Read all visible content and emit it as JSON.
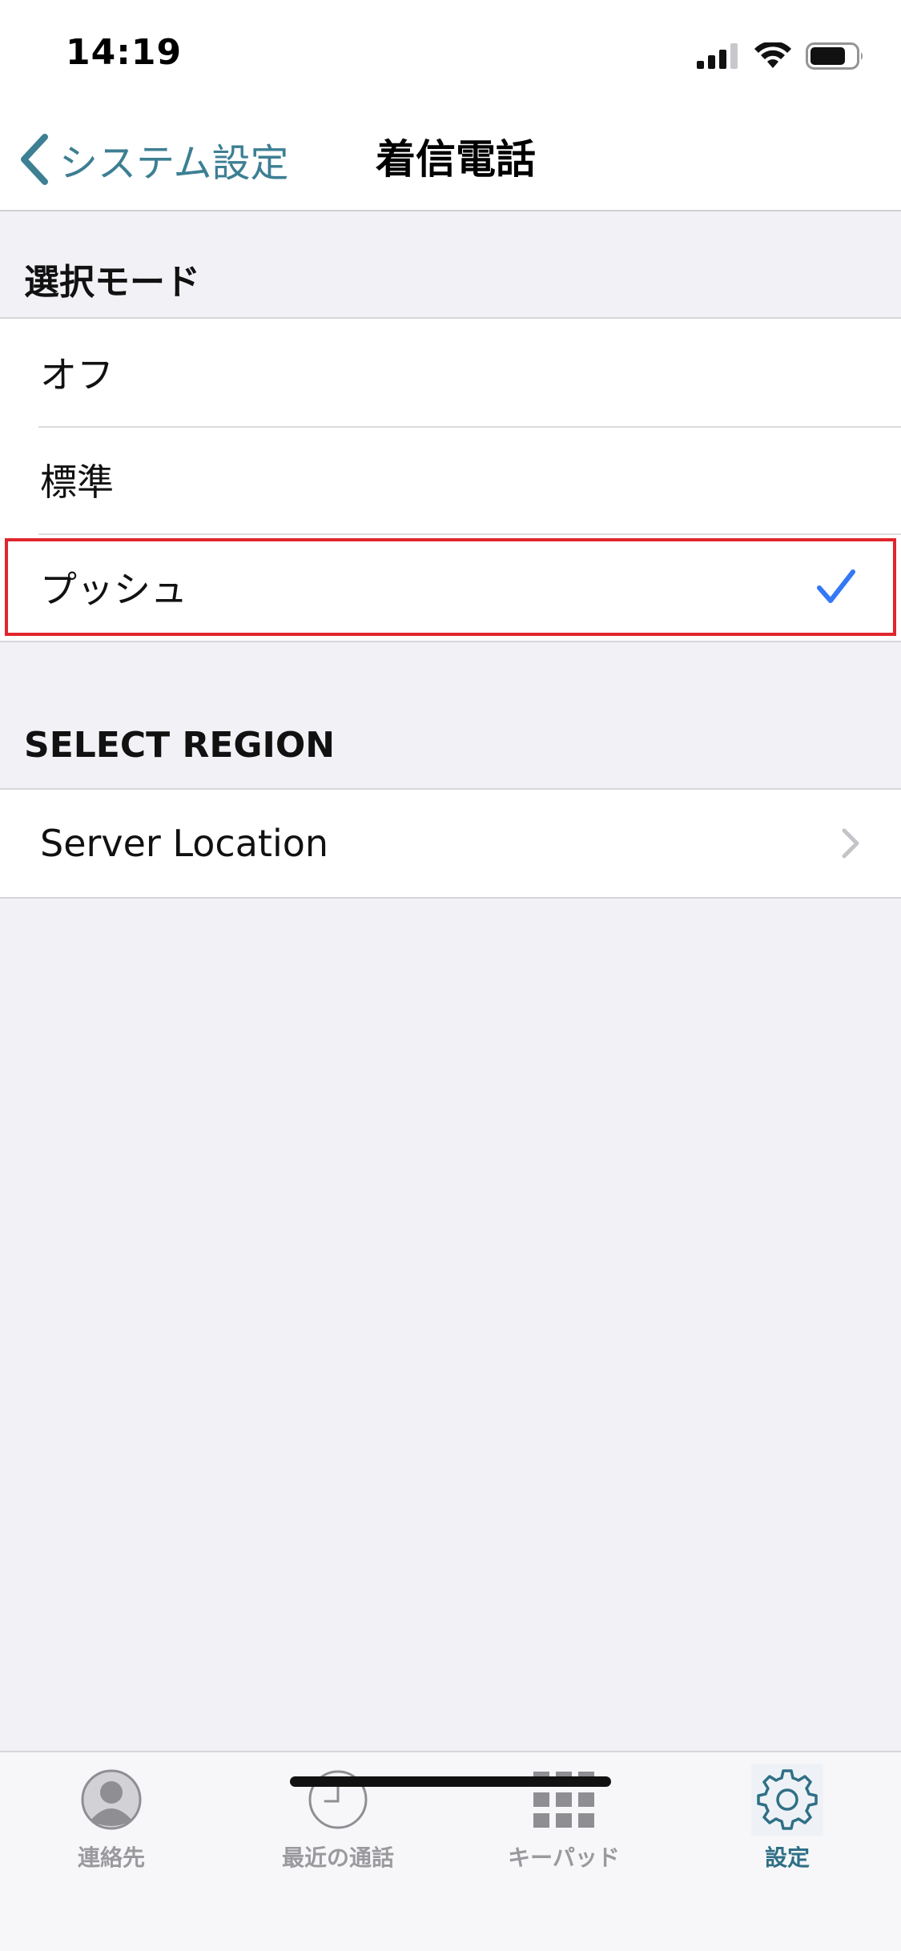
{
  "status_bar": {
    "time": "14:19"
  },
  "nav": {
    "back_label": "システム設定",
    "title": "着信電話"
  },
  "sections": {
    "mode": {
      "header": "選択モード",
      "items": [
        {
          "label": "オフ",
          "selected": false
        },
        {
          "label": "標準",
          "selected": false
        },
        {
          "label": "プッシュ",
          "selected": true
        }
      ]
    },
    "region": {
      "header": "SELECT REGION",
      "items": [
        {
          "label": "Server Location"
        }
      ]
    }
  },
  "tab_bar": {
    "tabs": [
      {
        "label": "連絡先",
        "icon": "contact-icon",
        "active": false
      },
      {
        "label": "最近の通話",
        "icon": "clock-icon",
        "active": false
      },
      {
        "label": "キーパッド",
        "icon": "keypad-icon",
        "active": false
      },
      {
        "label": "設定",
        "icon": "gear-icon",
        "active": true
      }
    ]
  },
  "colors": {
    "accent": "#3d7f93",
    "check": "#3478f6",
    "highlight": "#e0262d",
    "tab_active": "#2f6f86",
    "tab_inactive": "#9a9a9e"
  }
}
